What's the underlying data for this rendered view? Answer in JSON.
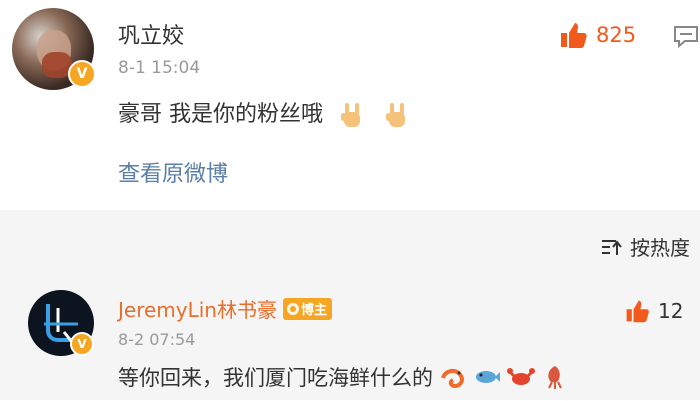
{
  "comment": {
    "user_name": "巩立姣",
    "time": "8-1 15:04",
    "text": "豪哥 我是你的粉丝哦",
    "link": "查看原微博",
    "likes": "825",
    "verify_badge": "V",
    "emojis": [
      "rock-hand-emoji",
      "rock-hand-emoji"
    ]
  },
  "toolbar": {
    "sort_label": "按热度"
  },
  "reply": {
    "user_name": "JeremyLin林书豪",
    "badge": "博主",
    "time": "8-2 07:54",
    "text": "等你回来，我们厦门吃海鲜什么的",
    "likes": "12",
    "verify_badge": "V",
    "emojis": [
      "shrimp-emoji",
      "fish-emoji",
      "crab-emoji",
      "squid-emoji"
    ]
  },
  "colors": {
    "accent_orange": "#f25a1b",
    "link_blue": "#5b7fa6",
    "badge_gold": "#f6a623",
    "muted": "#999999"
  }
}
